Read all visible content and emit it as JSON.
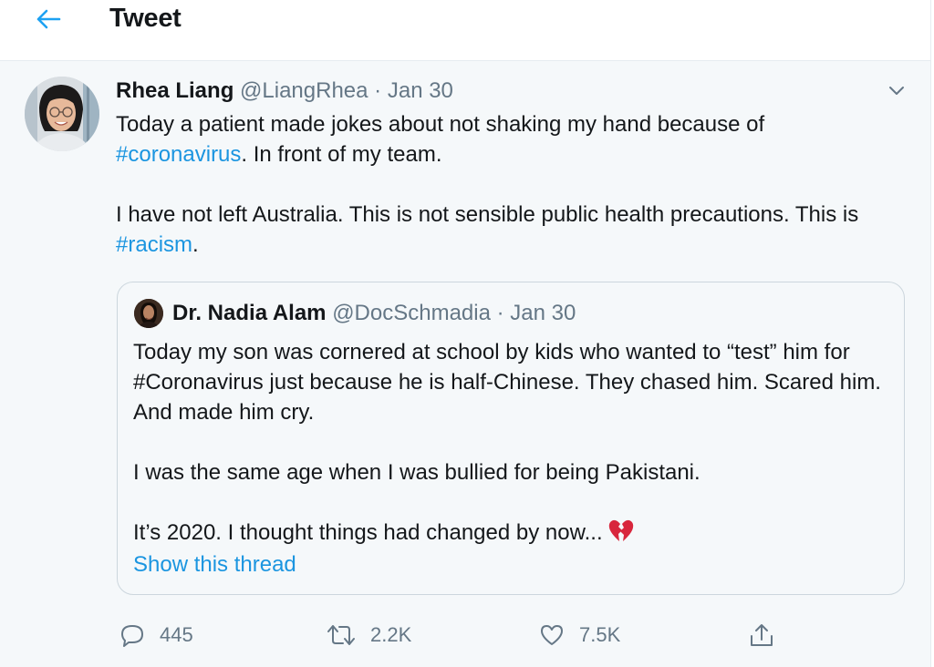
{
  "header": {
    "title": "Tweet",
    "back_icon": "arrow-left-icon",
    "accent": "#1da1f2"
  },
  "tweet": {
    "author_name": "Rhea Liang",
    "handle": "@LiangRhea",
    "separator": "·",
    "date": "Jan 30",
    "text_line1": "Today a patient made jokes about not shaking my hand because of",
    "hashtag_coronavirus": "#coronavirus",
    "text_line2_rest": ". In front of my team.",
    "text_para2": "I have not left Australia. This is not sensible public health precautions. This is ",
    "hashtag_racism": "#racism",
    "text_end": ".",
    "hashtag_color": "#1b95e0"
  },
  "quoted_tweet": {
    "author_name": "Dr. Nadia Alam",
    "handle": "@DocSchmadia",
    "separator": "·",
    "date": "Jan 30",
    "para1": "Today my son was cornered at school by kids who wanted to “test” him for #Coronavirus just because he is half-Chinese. They chased him. Scared him. And made him cry.",
    "para2": "I was the same age when I was bullied for being Pakistani.",
    "para3": "It’s 2020. I thought things had changed by now...",
    "emoji": "broken-heart-icon",
    "show_thread": "Show this thread"
  },
  "actions": {
    "reply_count": "445",
    "retweet_count": "2.2K",
    "like_count": "7.5K"
  }
}
